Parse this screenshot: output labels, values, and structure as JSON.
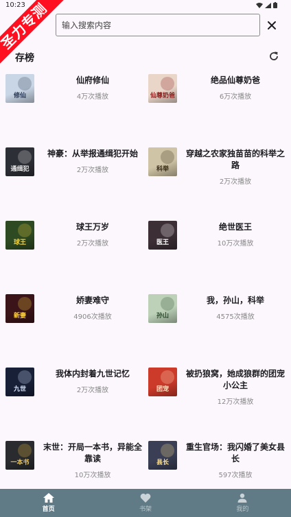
{
  "status": {
    "time": "10:23"
  },
  "watermark": "圣力专测",
  "search": {
    "placeholder": "输入搜索内容"
  },
  "section": {
    "title": "存榜"
  },
  "books": [
    {
      "title": "仙府修仙",
      "plays": "4万次播放"
    },
    {
      "title": "绝品仙尊奶爸",
      "plays": "6万次播放"
    },
    {
      "title": "神豪：从举报通缉犯开始",
      "plays": "2万次播放"
    },
    {
      "title": "穿越之农家独苗苗的科举之路",
      "plays": "2万次播放"
    },
    {
      "title": "球王万岁",
      "plays": "2万次播放"
    },
    {
      "title": "绝世医王",
      "plays": "10万次播放"
    },
    {
      "title": "娇妻难守",
      "plays": "4906次播放"
    },
    {
      "title": "我，孙山，科举",
      "plays": "4575次播放"
    },
    {
      "title": "我体内封着九世记忆",
      "plays": "2万次播放"
    },
    {
      "title": "被扔狼窝，她成狼群的团宠小公主",
      "plays": "12万次播放"
    },
    {
      "title": "末世：开局一本书，异能全靠读",
      "plays": "10万次播放"
    },
    {
      "title": "重生官场：我闪婚了美女县长",
      "plays": "597次播放"
    }
  ],
  "covers": [
    {
      "bg": "#c9d6e6",
      "fg": "#2b3a55",
      "text": "修仙"
    },
    {
      "bg": "#e9d6c9",
      "fg": "#8b1a1a",
      "text": "仙尊奶爸"
    },
    {
      "bg": "#2d2f36",
      "fg": "#e8e8e8",
      "text": "通缉犯"
    },
    {
      "bg": "#cfc4a5",
      "fg": "#3a2a1a",
      "text": "科举"
    },
    {
      "bg": "#2e4a22",
      "fg": "#f0d040",
      "text": "球王"
    },
    {
      "bg": "#3c2f36",
      "fg": "#ffffff",
      "text": "医王"
    },
    {
      "bg": "#3a1418",
      "fg": "#ffd23f",
      "text": "新妻"
    },
    {
      "bg": "#bcd1b8",
      "fg": "#2c4a2c",
      "text": "孙山"
    },
    {
      "bg": "#182038",
      "fg": "#d8e6ff",
      "text": "九世"
    },
    {
      "bg": "#cc3a2a",
      "fg": "#ffe9c6",
      "text": "团宠"
    },
    {
      "bg": "#2a2b2e",
      "fg": "#f0c040",
      "text": "一本书"
    },
    {
      "bg": "#3a3f55",
      "fg": "#ffe08a",
      "text": "县长"
    }
  ],
  "nav": [
    {
      "label": "首页",
      "icon": "home-icon",
      "active": true
    },
    {
      "label": "书架",
      "icon": "heart-icon",
      "active": false
    },
    {
      "label": "我的",
      "icon": "person-icon",
      "active": false
    }
  ],
  "colors": {
    "nav_bg": "#607b86",
    "ribbon": "#ff0f1f"
  }
}
